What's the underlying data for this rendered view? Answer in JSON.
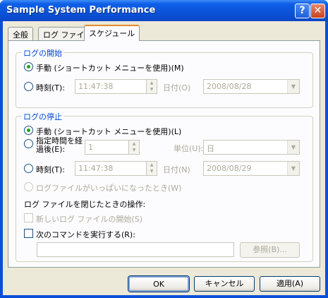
{
  "window": {
    "title": "Sample System Performance",
    "help_glyph": "?",
    "close_glyph": "✕"
  },
  "tabs": [
    {
      "label": "全般",
      "active": false
    },
    {
      "label": "ログ ファイル",
      "active": false
    },
    {
      "label": "スケジュール",
      "active": true
    }
  ],
  "start_group": {
    "legend": "ログの開始",
    "manual_label": "手動 (ショートカット メニューを使用)(M)",
    "manual_selected": true,
    "time_label": "時刻(T):",
    "time_value": "11:47:38",
    "date_label": "日付(O)",
    "date_value": "2008/08/28"
  },
  "stop_group": {
    "legend": "ログの停止",
    "manual_label": "手動 (ショートカット メニューを使用)(L)",
    "manual_selected": true,
    "after_label_line1": "指定時間を経",
    "after_label_line2": "過後(E):",
    "after_value": "1",
    "unit_label": "単位(U):",
    "unit_value": "日",
    "time_label": "時刻(T):",
    "time_value": "11:47:38",
    "date_label": "日付(N)",
    "date_value": "2008/08/29",
    "full_label": "ログファイルがいっぱいになったとき(W)",
    "on_close_label": "ログ ファイルを閉じたときの操作:",
    "new_log_label": "新しいログ ファイルの開始(S)",
    "run_command_label": "次のコマンドを実行する(R):",
    "command_value": "",
    "browse_label": "参照(B)..."
  },
  "footer": {
    "ok_label": "OK",
    "cancel_label": "キャンセル",
    "apply_label": "適用(A)"
  },
  "colors": {
    "title_bar": "#0a53d8",
    "dialog_bg": "#ece9d8",
    "legend_text": "#0046d5",
    "active_tab_accent": "#e68b2c",
    "radio_dot": "#21a121"
  }
}
